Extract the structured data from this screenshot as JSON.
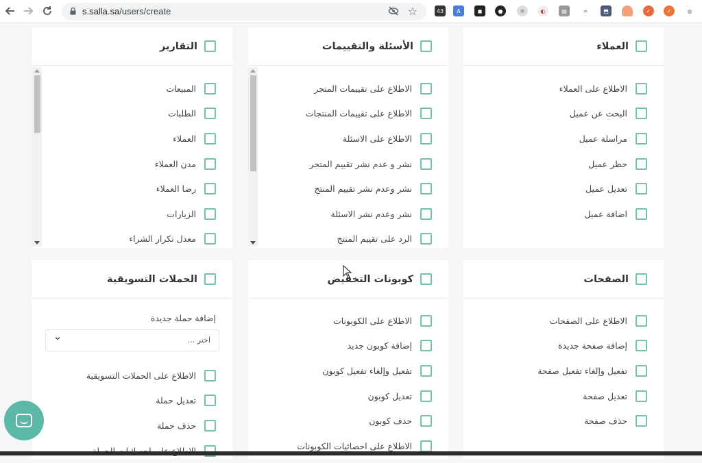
{
  "browser": {
    "url_host": "s.salla.sa",
    "url_path": "/users/create",
    "back_icon": "arrow-left-icon",
    "forward_icon": "arrow-right-icon",
    "reload_icon": "reload-icon",
    "extension_badge": "43"
  },
  "cards": [
    {
      "title": "العملاء",
      "items": [
        "الاطلاع على العملاء",
        "البحث عن عميل",
        "مراسلة عميل",
        "حظر عميل",
        "تعديل عميل",
        "اضافة عميل"
      ]
    },
    {
      "title": "الأسئلة والتقييمات",
      "items": [
        "الاطلاع على تقييمات المتجر",
        "الاطلاع على تقييمات المنتجات",
        "الاطلاع على الاسئلة",
        "نشر و عدم نشر تقييم المتجر",
        "نشر وعدم نشر تقييم المنتج",
        "نشر وعدم نشر الاسئلة",
        "الرد على تقييم المنتج"
      ]
    },
    {
      "title": "التقارير",
      "items": [
        "المبيعات",
        "الطلبات",
        "العملاء",
        "مدن العملاء",
        "رضا العملاء",
        "الزيارات",
        "معدل تكرار الشراء"
      ]
    },
    {
      "title": "الصفحات",
      "items": [
        "الاطلاع على الصفحات",
        "إضافة صفحة جديدة",
        "تفعيل وإلغاء تفعيل صفحة",
        "تعديل صفحة",
        "حذف صفحة"
      ]
    },
    {
      "title": "كوبونات التخفيض",
      "items": [
        "الاطلاع على الكوبونات",
        "إضافة كوبون جديد",
        "تفعيل وإلغاء تفعيل كوبون",
        "تعديل كوبون",
        "حذف كوبون",
        "الاطلاع على احصائيات الكوبونات"
      ]
    },
    {
      "title": "الحملات التسويقية",
      "new_campaign_label": "إضافة حملة جديدة",
      "select_placeholder": "اختر ...",
      "items": [
        "الاطلاع على الحملات التسويقية",
        "تعديل حملة",
        "حذف حملة",
        "الاطلاع على احصائيات الحملة"
      ]
    }
  ],
  "colors": {
    "checkbox_border": "#76c0ae",
    "chat_button": "#5bb7a6"
  },
  "chat_icon": "chat-bubble-icon"
}
